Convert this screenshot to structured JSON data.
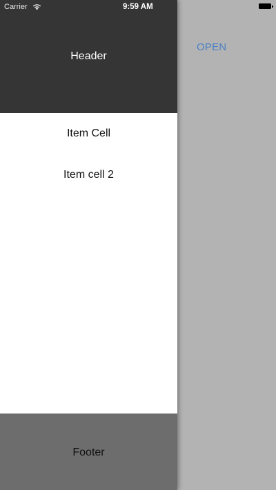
{
  "status_bar": {
    "carrier": "Carrier",
    "time": "9:59 AM"
  },
  "main": {
    "open_label": "OPEN",
    "open_color": "#4a7fc4",
    "background_color": "#b3b3b3"
  },
  "drawer": {
    "header": {
      "title": "Header",
      "background_color": "#353535"
    },
    "items": [
      {
        "label": "Item Cell"
      },
      {
        "label": "Item cell 2"
      }
    ],
    "footer": {
      "title": "Footer",
      "background_color": "#6d6d6d"
    }
  }
}
